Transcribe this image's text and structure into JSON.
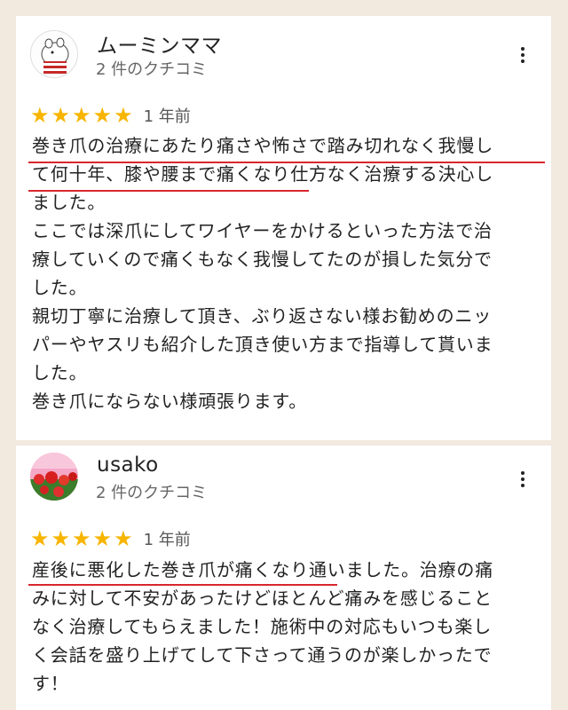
{
  "colors": {
    "background": "#f2e9df",
    "card": "#ffffff",
    "star": "#f7b500",
    "underline": "#d8262f"
  },
  "reviews": [
    {
      "name": "ムーミンママ",
      "review_count": "2 件のクチコミ",
      "rating": 5,
      "stars": [
        "★",
        "★",
        "★",
        "★",
        "★"
      ],
      "time": "1 年前",
      "lines": [
        "巻き爪の治療にあたり痛さや怖さで踏み切れなく我慢し",
        "て何十年、膝や腰まで痛くなり仕方なく治療する決心し",
        "ました。",
        "ここでは深爪にしてワイヤーをかけるといった方法で治",
        "療していくので痛くもなく我慢してたのが損した気分で",
        "した。",
        "親切丁寧に治療して頂き、ぶり返さない様お勧めのニッ",
        "パーやヤスリも紹介した頂き使い方まで指導して貰いま",
        "した。",
        "巻き爪にならない様頑張ります。"
      ]
    },
    {
      "name": "usako",
      "review_count": "2 件のクチコミ",
      "rating": 5,
      "stars": [
        "★",
        "★",
        "★",
        "★",
        "★"
      ],
      "time": "1 年前",
      "lines": [
        "産後に悪化した巻き爪が痛くなり通いました。治療の痛",
        "みに対して不安があったけどほとんど痛みを感じること",
        "なく治療してもらえました！施術中の対応もいつも楽し",
        "く会話を盛り上げてして下さって通うのが楽しかったで",
        "す！"
      ]
    }
  ]
}
